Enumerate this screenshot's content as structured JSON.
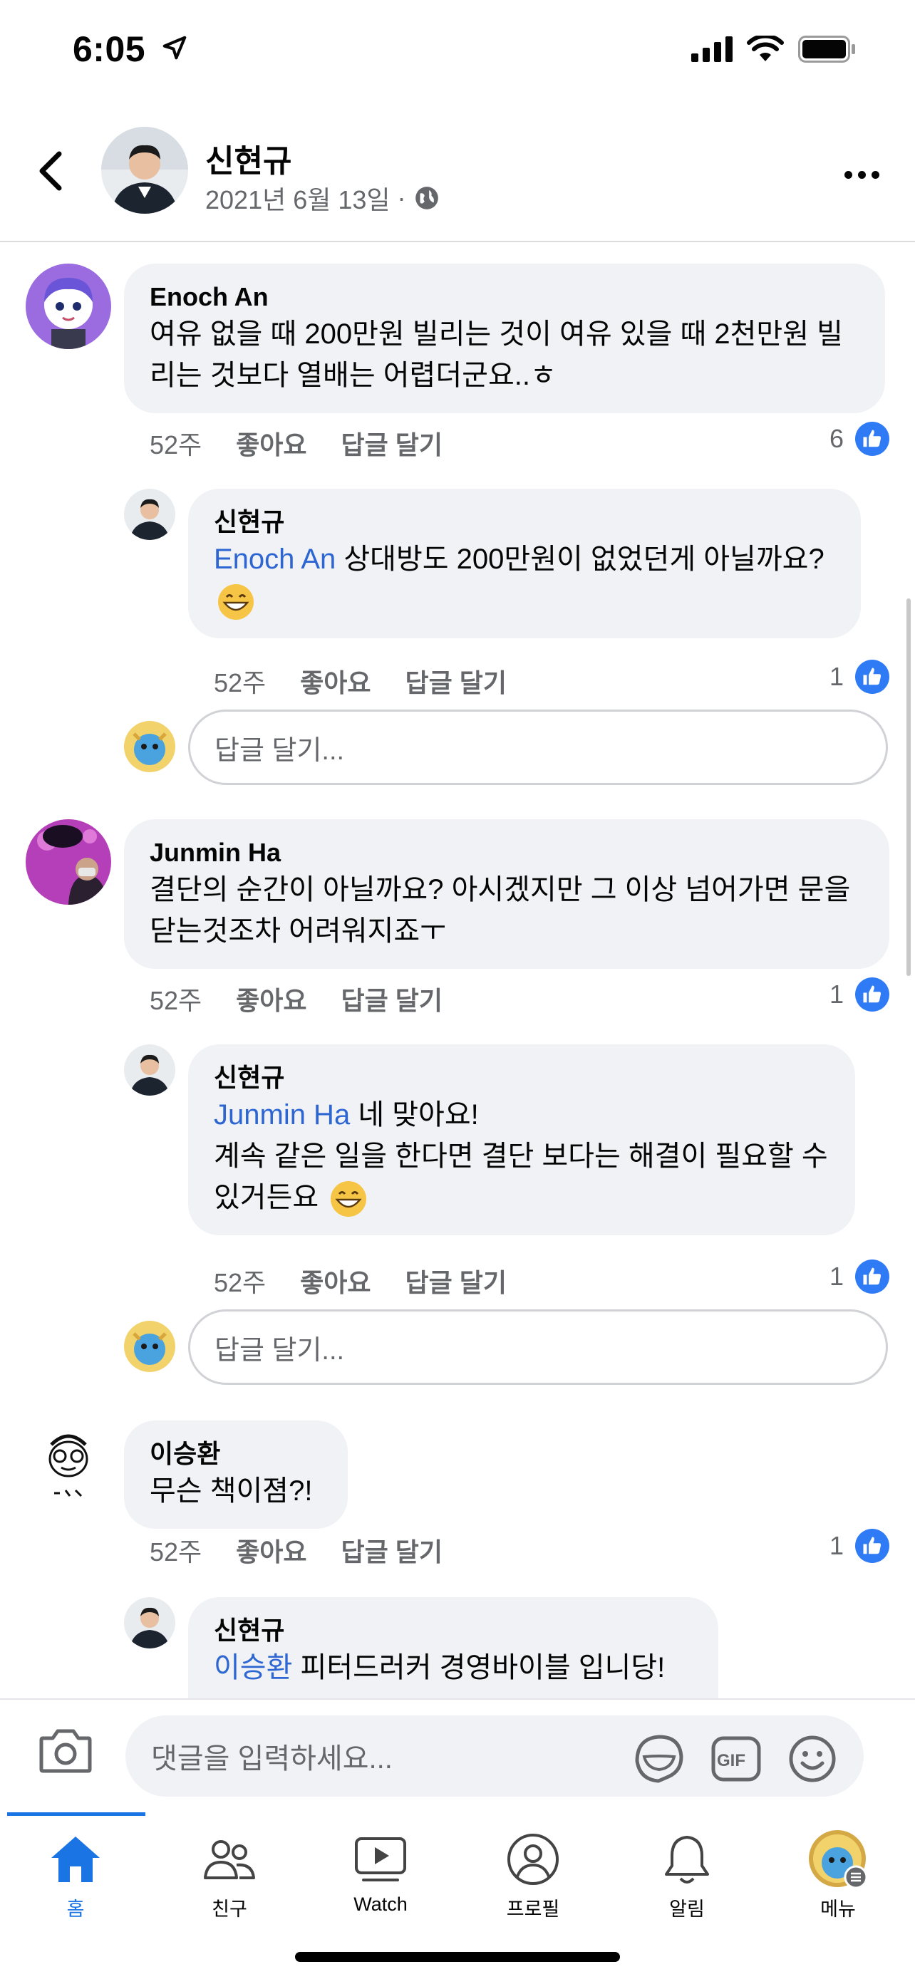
{
  "status_bar": {
    "time": "6:05"
  },
  "header": {
    "name": "신현규",
    "date": "2021년 6월 13일",
    "separator": "·"
  },
  "comments": [
    {
      "name": "Enoch An",
      "text": "여유 없을 때 200만원 빌리는 것이 여유 있을 때 2천만원 빌리는 것보다 열배는 어렵더군요..ㅎ",
      "time": "52주",
      "like_label": "좋아요",
      "reply_label": "답글 달기",
      "likes": "6"
    },
    {
      "name": "신현규",
      "mention": "Enoch An",
      "text": " 상대방도 200만원이 없었던게 아닐까요? ",
      "time": "52주",
      "like_label": "좋아요",
      "reply_label": "답글 달기",
      "likes": "1"
    },
    {
      "name": "Junmin Ha",
      "text": "결단의 순간이 아닐까요? 아시겠지만 그 이상 넘어가면 문을 닫는것조차 어려워지죠ㅜ",
      "time": "52주",
      "like_label": "좋아요",
      "reply_label": "답글 달기",
      "likes": "1"
    },
    {
      "name": "신현규",
      "mention": "Junmin Ha",
      "text_line1": " 네 맞아요!",
      "text_line2": "계속 같은 일을 한다면 결단 보다는 해결이 필요할 수 있거든요 ",
      "time": "52주",
      "like_label": "좋아요",
      "reply_label": "답글 달기",
      "likes": "1"
    },
    {
      "name": "이승환",
      "text": "무슨 책이졈?!",
      "time": "52주",
      "like_label": "좋아요",
      "reply_label": "답글 달기",
      "likes": "1"
    },
    {
      "name": "신현규",
      "mention": "이승환",
      "text": " 피터드러커 경영바이블 입니당!"
    }
  ],
  "reply_placeholder": "답글 달기...",
  "compose": {
    "placeholder": "댓글을 입력하세요...",
    "gif_label": "GIF"
  },
  "tabs": [
    {
      "label": "홈",
      "icon": "home-icon",
      "active": true
    },
    {
      "label": "친구",
      "icon": "friends-icon"
    },
    {
      "label": "Watch",
      "icon": "watch-icon"
    },
    {
      "label": "프로필",
      "icon": "profile-icon"
    },
    {
      "label": "알림",
      "icon": "bell-icon"
    },
    {
      "label": "메뉴",
      "icon": "menu-avatar-icon"
    }
  ],
  "colors": {
    "accent": "#1b74e4",
    "mention": "#2d66d3",
    "bubble": "#f0f2f5",
    "like": "#2f7bf5"
  }
}
